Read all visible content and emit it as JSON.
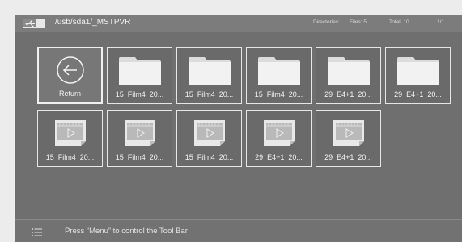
{
  "header": {
    "path": "/usb/sda1/_MSTPVR",
    "directories_label": "Directories:",
    "files_label": "Files: 5",
    "total_label": "Total: 10",
    "page_label": "1/1",
    "icon": "usb-drive-icon"
  },
  "items": [
    {
      "type": "return",
      "label": "Return",
      "icon": "back-arrow-icon"
    },
    {
      "type": "folder",
      "label": "15_Film4_20...",
      "icon": "folder-icon"
    },
    {
      "type": "folder",
      "label": "15_Film4_20...",
      "icon": "folder-icon"
    },
    {
      "type": "folder",
      "label": "15_Film4_20...",
      "icon": "folder-icon"
    },
    {
      "type": "folder",
      "label": "29_E4+1_20...",
      "icon": "folder-icon"
    },
    {
      "type": "folder",
      "label": "29_E4+1_20...",
      "icon": "folder-icon"
    },
    {
      "type": "video",
      "label": "15_Film4_20...",
      "icon": "video-file-icon"
    },
    {
      "type": "video",
      "label": "15_Film4_20...",
      "icon": "video-file-icon"
    },
    {
      "type": "video",
      "label": "15_Film4_20...",
      "icon": "video-file-icon"
    },
    {
      "type": "video",
      "label": "29_E4+1_20...",
      "icon": "video-file-icon"
    },
    {
      "type": "video",
      "label": "29_E4+1_20...",
      "icon": "video-file-icon"
    }
  ],
  "footer": {
    "hint": "Press “Menu” to control the Tool Bar",
    "icon": "menu-list-icon"
  },
  "colors": {
    "screen_bg": "#6f6f6f",
    "bar_bg": "#7c7c7c",
    "outer_bg": "#ececec",
    "text": "#f0f0f0"
  }
}
